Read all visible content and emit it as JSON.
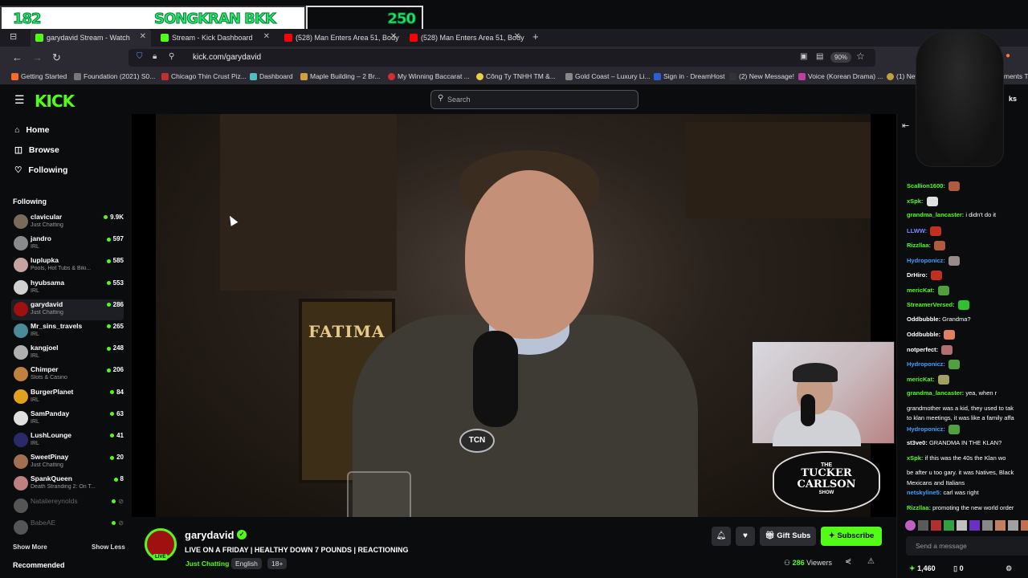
{
  "overlay": {
    "left_number": "182",
    "title": "SONGKRAN BKK",
    "score": "250"
  },
  "browser": {
    "tabs": [
      {
        "label": "garydavid Stream - Watch",
        "color": "#53fc18"
      },
      {
        "label": "Stream - Kick Dashboard",
        "color": "#53fc18"
      },
      {
        "label": "(528) Man Enters Area 51, Body",
        "color": "#ff0000"
      },
      {
        "label": "(528) Man Enters Area 51, Body",
        "color": "#ff0000"
      }
    ],
    "url": "kick.com/garydavid",
    "zoom": "90%",
    "bookmarks": [
      "Getting Started",
      "Foundation (2021) S0...",
      "Chicago Thin Crust Piz...",
      "Dashboard",
      "Maple Building – 2 Br...",
      "My Winning Baccarat ...",
      "Công Ty TNHH TM &...",
      "Gold Coast – Luxury Li...",
      "Sign in · DreamHost",
      "(2) New Message!",
      "Voice (Korean Drama) ...",
      "(1) New M",
      "ments T"
    ]
  },
  "kick": {
    "logo": "KICK",
    "search_placeholder": "Search",
    "nav": [
      "Home",
      "Browse",
      "Following"
    ],
    "following_header": "Following",
    "recommended_header": "Recommended",
    "show_more": "Show More",
    "show_less": "Show Less",
    "channels": [
      {
        "name": "clavicular",
        "category": "Just Chatting",
        "viewers": "9.9K",
        "color": "#7a6a5a"
      },
      {
        "name": "jandro",
        "category": "IRL",
        "viewers": "597",
        "color": "#8a8a8a"
      },
      {
        "name": "luplupka",
        "category": "Pools, Hot Tubs & Biki...",
        "viewers": "585",
        "color": "#c7a3a0"
      },
      {
        "name": "hyubsama",
        "category": "IRL",
        "viewers": "553",
        "color": "#d0d0d0"
      },
      {
        "name": "garydavid",
        "category": "Just Chatting",
        "viewers": "286",
        "color": "#a01010"
      },
      {
        "name": "Mr_sins_travels",
        "category": "IRL",
        "viewers": "265",
        "color": "#4a8a9a"
      },
      {
        "name": "kangjoel",
        "category": "IRL",
        "viewers": "248",
        "color": "#b0b0b0"
      },
      {
        "name": "Chimper",
        "category": "Slots & Casino",
        "viewers": "206",
        "color": "#c08040"
      },
      {
        "name": "BurgerPlanet",
        "category": "IRL",
        "viewers": "84",
        "color": "#e0a020"
      },
      {
        "name": "SamPanday",
        "category": "IRL",
        "viewers": "63",
        "color": "#e0e0e0"
      },
      {
        "name": "LushLounge",
        "category": "IRL",
        "viewers": "41",
        "color": "#2a2a6a"
      },
      {
        "name": "SweetPinay",
        "category": "Just Chatting",
        "viewers": "20",
        "color": "#a07050"
      },
      {
        "name": "SpankQueen",
        "category": "Death Stranding 2: On T...",
        "viewers": "8",
        "color": "#c08080"
      },
      {
        "name": "Nataliereynolds",
        "category": "",
        "viewers": "",
        "color": "#555555"
      },
      {
        "name": "BabeAE",
        "category": "",
        "viewers": "",
        "color": "#555555"
      }
    ]
  },
  "video": {
    "poster_text": "FATIMA",
    "mic_label": "TCN",
    "logo_top": "THE",
    "logo_main": "TUCKER CARLSON",
    "logo_bottom": "SHOW"
  },
  "stream": {
    "username": "garydavid",
    "live_label": "LIVE",
    "title": "LIVE ON A FRIDAY | HEALTHY DOWN 7 POUNDS | REACTIONING",
    "category": "Just Chatting",
    "tags": [
      "English",
      "18+"
    ],
    "gift_label": "Gift Subs",
    "subscribe_label": "Subscribe",
    "viewers": "286",
    "viewers_label": "Viewers"
  },
  "chat": {
    "messages": [
      {
        "user": "Scallion1600:",
        "text": "",
        "color": "#53fc18",
        "emote": "#b05a40"
      },
      {
        "user": "xSpk:",
        "text": "",
        "color": "#53fc18",
        "emote": "#e0e0e0"
      },
      {
        "user": "grandma_lancaster:",
        "text": "i didn't do it",
        "color": "#53fc18",
        "emote": ""
      },
      {
        "user": "LLWW:",
        "text": "",
        "color": "#7a8cff",
        "emote": "#c03020"
      },
      {
        "user": "Rizzllaa:",
        "text": "",
        "color": "#53fc18",
        "emote": "#b05a40"
      },
      {
        "user": "Hydroponicz:",
        "text": "",
        "color": "#3aa0ff",
        "emote": "#9a8a8a"
      },
      {
        "user": "DrHiro:",
        "text": "",
        "color": "#ffffff",
        "emote": "#c03020"
      },
      {
        "user": "mericKat:",
        "text": "",
        "color": "#53fc18",
        "emote": "#50a040"
      },
      {
        "user": "StreamerVersed:",
        "text": "",
        "color": "#53fc18",
        "emote": "#30c030"
      },
      {
        "user": "Oddbubble:",
        "text": "Grandma?",
        "color": "#ffffff",
        "emote": ""
      },
      {
        "user": "Oddbubble:",
        "text": "",
        "color": "#ffffff",
        "emote": "#e08060"
      },
      {
        "user": "notperfect:",
        "text": "",
        "color": "#ffffff",
        "emote": "#b07070"
      },
      {
        "user": "Hydroponicz:",
        "text": "",
        "color": "#3aa0ff",
        "emote": "#50a040"
      },
      {
        "user": "mericKat:",
        "text": "",
        "color": "#53fc18",
        "emote": "#a0a060"
      },
      {
        "user": "grandma_lancaster:",
        "text": "yea, when r",
        "color": "#53fc18",
        "emote": ""
      },
      {
        "user": "",
        "text": "grandmother was a kid, they used to tak",
        "color": "#ffffff",
        "emote": ""
      },
      {
        "user": "",
        "text": "to klan meetings, it was like a family affa",
        "color": "#ffffff",
        "emote": ""
      },
      {
        "user": "Hydroponicz:",
        "text": "",
        "color": "#3aa0ff",
        "emote": "#50a040"
      },
      {
        "user": "st3ve0:",
        "text": "GRANDMA IN THE KLAN?",
        "color": "#ffffff",
        "emote": ""
      },
      {
        "user": "xSpk:",
        "text": "if this was the 40s the Klan wo",
        "color": "#53fc18",
        "emote": ""
      },
      {
        "user": "",
        "text": "be after u too gary. it was Natives, Black",
        "color": "#ffffff",
        "emote": ""
      },
      {
        "user": "",
        "text": "Mexicans and Italians",
        "color": "#ffffff",
        "emote": ""
      },
      {
        "user": "netskyline5:",
        "text": "carl was right",
        "color": "#3aa0ff",
        "emote": ""
      },
      {
        "user": "Rizzllaa:",
        "text": "promoting the new world order",
        "color": "#53fc18",
        "emote": ""
      }
    ],
    "input_placeholder": "Send a message",
    "kicks_count": "1,460",
    "other_count": "0"
  }
}
